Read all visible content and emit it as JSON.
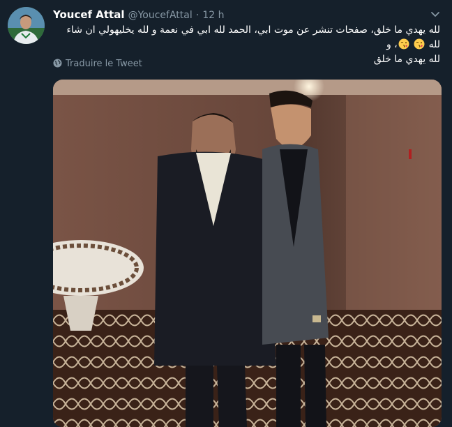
{
  "tweet": {
    "author_name": "Youcef Attal",
    "handle": "@YoucefAttal",
    "separator": "·",
    "time": "12 h",
    "text_lines": [
      "لله يهدي ما خلق، صفحات تنشر عن موت ابي، الحمد لله ابي في نعمة و لله يخليهولي ان شاء لله",
      "و",
      "لله يهدي ما خلق"
    ],
    "emojis": [
      "kissing-face-emoji",
      "kissing-face-emoji"
    ],
    "translate_label": "Traduire le Tweet"
  },
  "icons": {
    "menu": "chevron-down-icon",
    "translate": "globe-icon"
  },
  "colors": {
    "background": "#15202b",
    "secondary_text": "#8899a6",
    "primary_text": "#ffffff"
  }
}
